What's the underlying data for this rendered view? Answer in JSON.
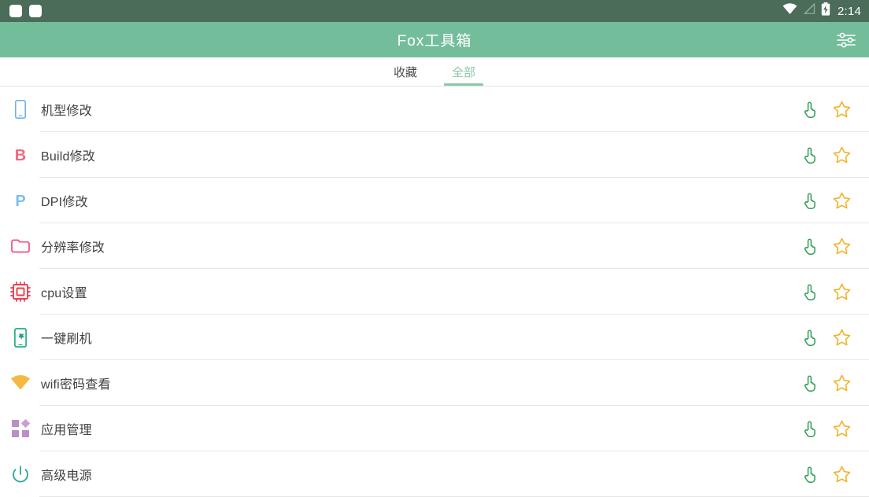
{
  "statusbar": {
    "notifications": [
      "notification-chip",
      "notification-chip"
    ],
    "icons": [
      "wifi-icon",
      "signal-off-icon",
      "battery-charging-icon"
    ],
    "clock": "2:14"
  },
  "appbar": {
    "title": "Fox工具箱",
    "action_icon": "tune-sliders-icon"
  },
  "tabs": [
    {
      "label": "收藏",
      "active": false
    },
    {
      "label": "全部",
      "active": true
    }
  ],
  "colors": {
    "statusbar_bg": "#4a6c58",
    "appbar_bg": "#74bd9b",
    "accent": "#8cc7a7",
    "text_primary": "#414141",
    "divider": "#e6e6e6",
    "star": "#f0b429",
    "touch": "#2f9e55"
  },
  "list": {
    "row_actions": {
      "run_icon": "touch-hand-icon",
      "favorite_icon": "star-outline-icon"
    },
    "items": [
      {
        "label": "机型修改",
        "icon": "phone-outline-icon",
        "icon_color": "#6fb3e8"
      },
      {
        "label": "Build修改",
        "icon": "letter-b-icon",
        "icon_color": "#ef6a80"
      },
      {
        "label": "DPI修改",
        "icon": "letter-p-icon",
        "icon_color": "#7cc0f0"
      },
      {
        "label": "分辨率修改",
        "icon": "folder-outline-icon",
        "icon_color": "#ef4e7b"
      },
      {
        "label": "cpu设置",
        "icon": "cpu-chip-icon",
        "icon_color": "#e8404f"
      },
      {
        "label": "一键刷机",
        "icon": "phone-flash-icon",
        "icon_color": "#19a974"
      },
      {
        "label": "wifi密码查看",
        "icon": "wifi-icon",
        "icon_color": "#f5b942"
      },
      {
        "label": "应用管理",
        "icon": "apps-grid-icon",
        "icon_color": "#b98fc4"
      },
      {
        "label": "高级电源",
        "icon": "power-icon",
        "icon_color": "#2aa898"
      }
    ]
  }
}
